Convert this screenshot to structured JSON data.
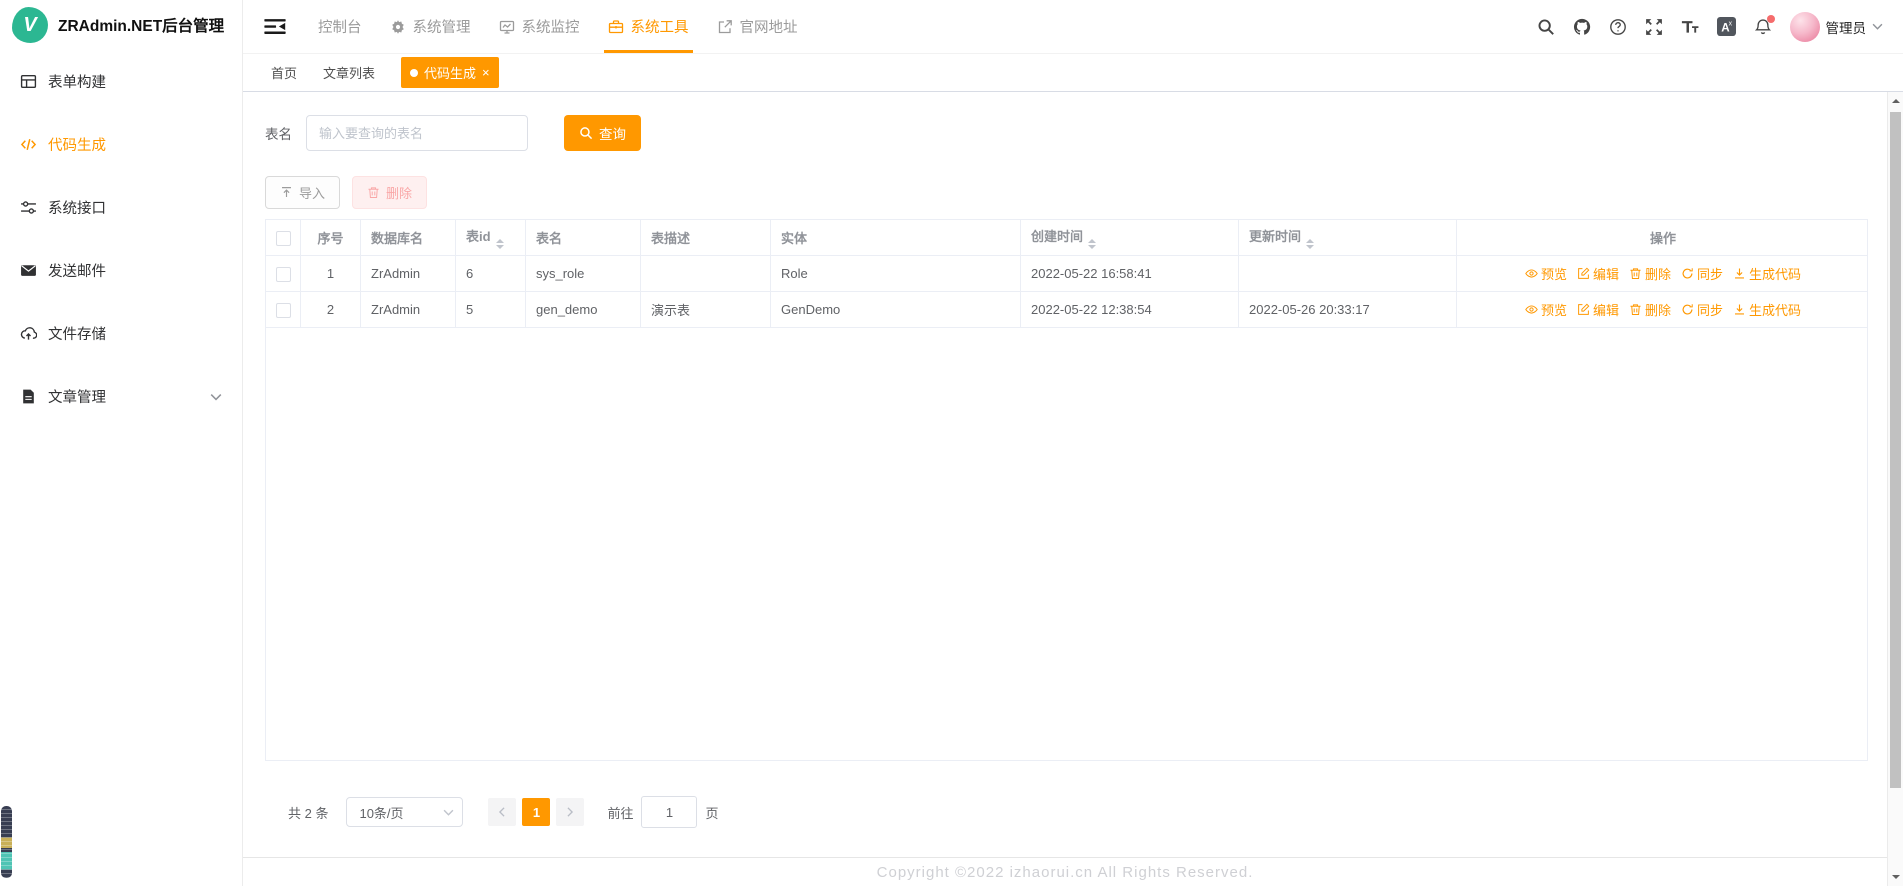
{
  "app": {
    "logo_text": "V",
    "title": "ZRAdmin.NET后台管理"
  },
  "sidebar": {
    "items": [
      {
        "label": "表单构建",
        "icon": "form-grid-icon",
        "active": false,
        "has_children": false
      },
      {
        "label": "代码生成",
        "icon": "code-icon",
        "active": true,
        "has_children": false
      },
      {
        "label": "系统接口",
        "icon": "sliders-icon",
        "active": false,
        "has_children": false
      },
      {
        "label": "发送邮件",
        "icon": "mail-icon",
        "active": false,
        "has_children": false
      },
      {
        "label": "文件存储",
        "icon": "cloud-upload-icon",
        "active": false,
        "has_children": false
      },
      {
        "label": "文章管理",
        "icon": "document-icon",
        "active": false,
        "has_children": true
      }
    ]
  },
  "navbar": {
    "menu": [
      {
        "label": "控制台",
        "icon": null,
        "active": false
      },
      {
        "label": "系统管理",
        "icon": "gear-icon",
        "active": false
      },
      {
        "label": "系统监控",
        "icon": "monitor-icon",
        "active": false
      },
      {
        "label": "系统工具",
        "icon": "toolbox-icon",
        "active": true
      },
      {
        "label": "官网地址",
        "icon": "external-link-icon",
        "active": false
      }
    ],
    "right_icons": [
      "search-icon",
      "github-icon",
      "question-icon",
      "fullscreen-icon",
      "font-size-icon",
      "language-icon",
      "bell-icon"
    ],
    "notification_dot": true,
    "user": {
      "name": "管理员"
    }
  },
  "tabs": [
    {
      "label": "首页",
      "active": false,
      "closable": false
    },
    {
      "label": "文章列表",
      "active": false,
      "closable": false
    },
    {
      "label": "代码生成",
      "active": true,
      "closable": true
    }
  ],
  "filter": {
    "label": "表名",
    "placeholder": "输入要查询的表名",
    "query_button": "查询"
  },
  "toolbar": {
    "import_button": "导入",
    "delete_button": "删除"
  },
  "table": {
    "columns": [
      {
        "label": "",
        "type": "checkbox"
      },
      {
        "label": "序号",
        "align": "center"
      },
      {
        "label": "数据库名"
      },
      {
        "label": "表id",
        "sortable": true
      },
      {
        "label": "表名"
      },
      {
        "label": "表描述"
      },
      {
        "label": "实体"
      },
      {
        "label": "创建时间",
        "sortable": true
      },
      {
        "label": "更新时间",
        "sortable": true
      },
      {
        "label": "操作",
        "align": "center"
      }
    ],
    "rows": [
      {
        "index": "1",
        "database": "ZrAdmin",
        "table_id": "6",
        "table_name": "sys_role",
        "description": "",
        "entity": "Role",
        "created_at": "2022-05-22 16:58:41",
        "updated_at": ""
      },
      {
        "index": "2",
        "database": "ZrAdmin",
        "table_id": "5",
        "table_name": "gen_demo",
        "description": "演示表",
        "entity": "GenDemo",
        "created_at": "2022-05-22 12:38:54",
        "updated_at": "2022-05-26 20:33:17"
      }
    ],
    "row_actions": [
      {
        "name": "preview",
        "label": "预览",
        "icon": "eye-icon"
      },
      {
        "name": "edit",
        "label": "编辑",
        "icon": "edit-icon"
      },
      {
        "name": "delete",
        "label": "删除",
        "icon": "trash-icon"
      },
      {
        "name": "sync",
        "label": "同步",
        "icon": "sync-icon"
      },
      {
        "name": "generate",
        "label": "生成代码",
        "icon": "download-icon"
      }
    ]
  },
  "pagination": {
    "total": "共 2 条",
    "page_size": "10条/页",
    "current_page": "1",
    "goto_label": "前往",
    "goto_value": "1",
    "goto_unit": "页"
  },
  "footer": {
    "copyright": "Copyright ©2022 izhaorui.cn All Rights Reserved."
  },
  "colors": {
    "accent": "#ff9800",
    "logo": "#2cb792",
    "danger_soft": "#f9a7a7",
    "active_tab": "#ff9800"
  }
}
